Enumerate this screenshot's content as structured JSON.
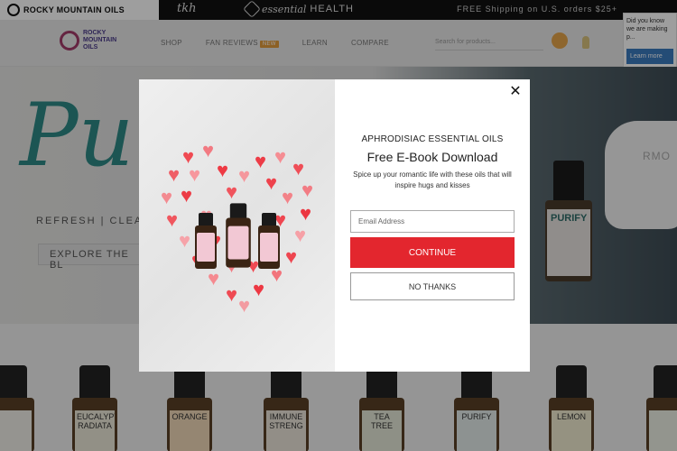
{
  "brandbar": {
    "rmo_name": "ROCKY MOUNTAIN OILS",
    "tkh_name": "tkh",
    "eh_name_a": "essential",
    "eh_name_b": "HEALTH",
    "shipping": "FREE Shipping on U.S. orders $25+"
  },
  "nav": {
    "logo_line1": "ROCKY",
    "logo_line2": "MOUNTAIN",
    "logo_line3": "OILS",
    "links": [
      "SHOP",
      "FAN REVIEWS",
      "LEARN",
      "COMPARE"
    ],
    "new_badge": "NEW",
    "search_placeholder": "Search for products..."
  },
  "side_tip": {
    "text": "Did you know we are making p...",
    "button": "Learn more"
  },
  "hero": {
    "script": "Puri",
    "tagline": "REFRESH | CLEANSE",
    "cta": "EXPLORE THE BL",
    "diffuser_brand": "RMO",
    "bottle_label": "PURIFY"
  },
  "products": [
    {
      "label": ""
    },
    {
      "label": "EUCALYPT RADIATA"
    },
    {
      "label": "ORANGE"
    },
    {
      "label": "IMMUNE STRENG"
    },
    {
      "label": "TEA TREE"
    },
    {
      "label": "PURIFY"
    },
    {
      "label": "LEMON"
    },
    {
      "label": ""
    }
  ],
  "modal": {
    "kicker": "APHRODISIAC ESSENTIAL OILS",
    "title": "Free E-Book Download",
    "subtitle": "Spice up your romantic life with these oils that will inspire hugs and kisses",
    "email_placeholder": "Email Address",
    "continue_label": "CONTINUE",
    "no_thanks_label": "NO THANKS",
    "close_glyph": "✕"
  }
}
